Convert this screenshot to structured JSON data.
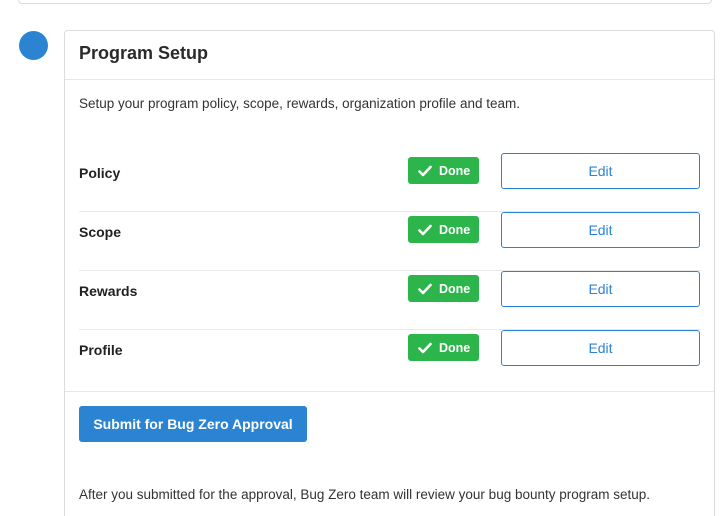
{
  "section": {
    "title": "Program Setup",
    "description": "Setup your program policy, scope, rewards, organization profile and team."
  },
  "items": [
    {
      "label": "Policy",
      "status": "Done",
      "action": "Edit"
    },
    {
      "label": "Scope",
      "status": "Done",
      "action": "Edit"
    },
    {
      "label": "Rewards",
      "status": "Done",
      "action": "Edit"
    },
    {
      "label": "Profile",
      "status": "Done",
      "action": "Edit"
    }
  ],
  "submit": {
    "label": "Submit for Bug Zero Approval"
  },
  "footer": {
    "note": "After you submitted for the approval, Bug Zero team will review your bug bounty program setup."
  },
  "colors": {
    "accent": "#2b84d2",
    "success": "#2bb54b"
  }
}
